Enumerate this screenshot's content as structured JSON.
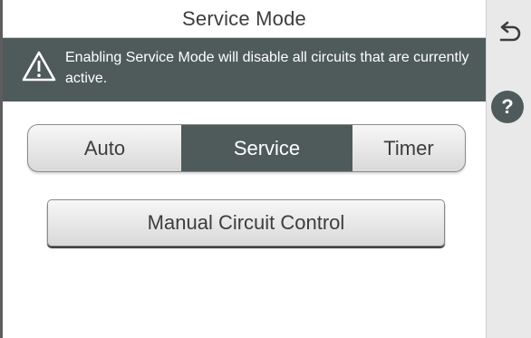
{
  "header": {
    "title": "Service Mode"
  },
  "warning": {
    "icon": "warning-icon",
    "text": "Enabling Service Mode will disable all circuits that are currently active."
  },
  "mode_selector": {
    "options": [
      {
        "label": "Auto",
        "selected": false
      },
      {
        "label": "Service",
        "selected": true
      },
      {
        "label": "Timer",
        "selected": false
      }
    ]
  },
  "manual_circuit_control": {
    "label": "Manual Circuit Control"
  },
  "side_panel": {
    "back_icon": "back-arrow-icon",
    "help_label": "?"
  },
  "colors": {
    "accent": "#4f5b5b",
    "side_panel": "#e9e9e9",
    "button_light": "#f7f7f7",
    "button_dark": "#d9d9d9"
  }
}
